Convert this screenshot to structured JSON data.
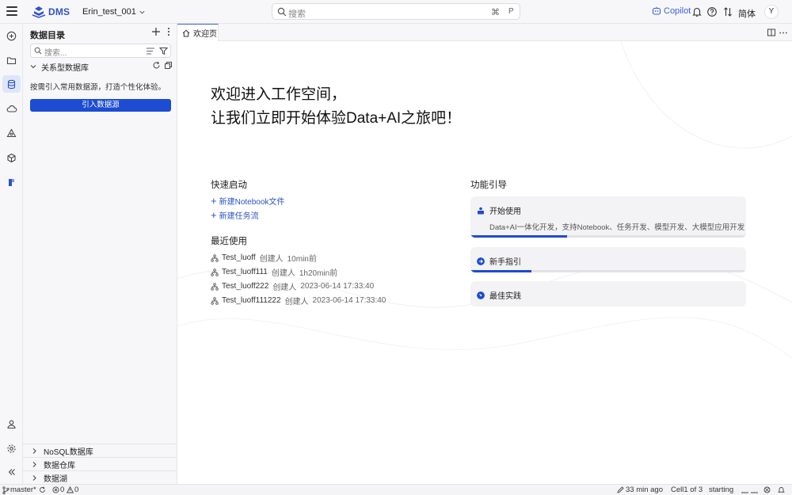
{
  "topbar": {
    "logo_text": "DMS",
    "workspace": "Erin_test_001",
    "search_placeholder": "搜索",
    "shortcut_symbol": "⌘",
    "shortcut_key": "P",
    "copilot_label": "Copilot",
    "language": "简体",
    "user_initial": "Y"
  },
  "sidebar": {
    "title": "数据目录",
    "search_placeholder": "搜索...",
    "relational_db": "关系型数据库",
    "hint": "按需引入常用数据源，打造个性化体验。",
    "import_button": "引入数据源",
    "bottom_sections": [
      "NoSQL数据库",
      "数据仓库",
      "数据湖"
    ]
  },
  "tabs": [
    {
      "label": "欢迎页",
      "active": true
    }
  ],
  "main": {
    "welcome_line1": "欢迎进入工作空间，",
    "welcome_line2": "让我们立即开始体验Data+AI之旅吧！",
    "quick_start_title": "快速启动",
    "quick_links": [
      "新建Notebook文件",
      "新建任务流"
    ],
    "recent_title": "最近使用",
    "recent_items": [
      {
        "name": "Test_luoff",
        "creator": "创建人",
        "time": "10min前"
      },
      {
        "name": "Test_luoff111",
        "creator": "创建人",
        "time": "1h20min前"
      },
      {
        "name": "Test_luoff222",
        "creator": "创建人",
        "time": "2023-06-14 17:33:40"
      },
      {
        "name": "Test_luoff111222",
        "creator": "创建人",
        "time": "2023-06-14 17:33:40"
      }
    ],
    "guide_title": "功能引导",
    "guides": [
      {
        "title": "开始使用",
        "description": "Data+AI一体化开发，支持Notebook、任务开发、模型开发、大模型应用开发",
        "progress": 0.35
      },
      {
        "title": "新手指引",
        "progress": 0.22
      },
      {
        "title": "最佳实践"
      }
    ]
  },
  "statusbar": {
    "branch": "master*",
    "errors": "0",
    "warnings": "0",
    "edited": "33 min ago",
    "cell": "Cell1 of 3",
    "kernel_state": "starting"
  },
  "colors": {
    "accent": "#1d4cd3",
    "link": "#2b52c6",
    "copilot": "#3a62d8"
  }
}
